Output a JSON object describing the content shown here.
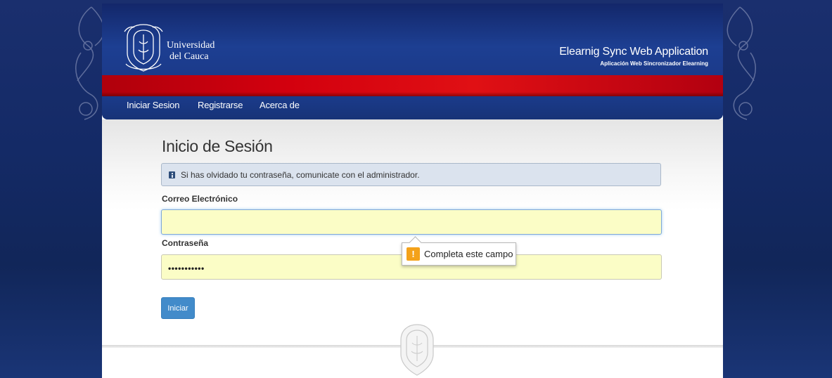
{
  "header": {
    "logo_line1": "Universidad",
    "logo_line2": "del Cauca",
    "app_title": "Elearnig Sync Web Application",
    "app_subtitle": "Aplicación Web Sincronizador Elearning"
  },
  "nav": {
    "items": [
      {
        "label": "Iniciar Sesion"
      },
      {
        "label": "Registrarse"
      },
      {
        "label": "Acerca de"
      }
    ]
  },
  "main": {
    "title": "Inicio de Sesión",
    "alert": "Si has olvidado tu contraseña, comunicate con el administrador.",
    "email_label": "Correo Electrónico",
    "email_value": "",
    "password_label": "Contraseña",
    "password_value": "•••••••••••",
    "validation_tooltip": "Completa este campo",
    "warning_icon": "!",
    "submit_label": "Iniciar"
  },
  "colors": {
    "header_blue": "#1c3e8f",
    "band_red": "#d3000e",
    "primary_button": "#428bca",
    "input_autofill": "#fbfdc6"
  },
  "icons": [
    "university-seal-icon",
    "info-icon",
    "warning-icon",
    "ornament-icon"
  ]
}
